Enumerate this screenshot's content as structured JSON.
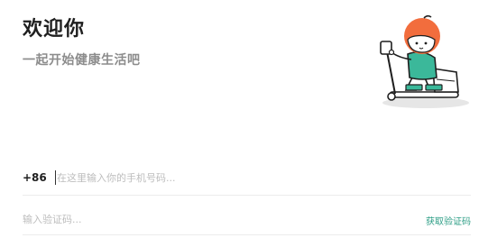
{
  "header": {
    "title": "欢迎你",
    "subtitle": "一起开始健康生活吧"
  },
  "illustration": {
    "icon": "person-on-elliptical-illustration",
    "colors": {
      "hair": "#f26d3d",
      "shirt": "#3bb89a",
      "machine": "#ffffff",
      "outline": "#1f1f1f",
      "shadow": "#e6e6e6"
    }
  },
  "phone": {
    "country_code": "+86",
    "placeholder": "在这里输入你的手机号码...",
    "value": ""
  },
  "verify": {
    "placeholder": "输入验证码...",
    "value": "",
    "get_code_label": "获取验证码"
  },
  "colors": {
    "accent": "#2e9e86",
    "title": "#1f1f1f",
    "subtitle": "#8c8c8c",
    "divider": "#ececec"
  }
}
